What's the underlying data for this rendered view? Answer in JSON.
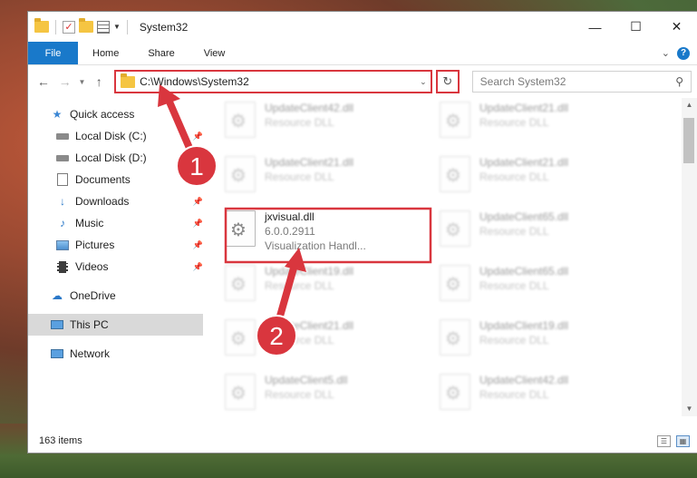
{
  "window": {
    "title": "System32",
    "controls": {
      "minimize": "—",
      "maximize": "☐",
      "close": "✕"
    }
  },
  "ribbon": {
    "tabs": [
      "File",
      "Home",
      "Share",
      "View"
    ],
    "expand_icon": "chevron-down-icon",
    "help_icon": "?"
  },
  "navbar": {
    "address": "C:\\Windows\\System32",
    "search_placeholder": "Search System32"
  },
  "sidebar": {
    "items": [
      {
        "label": "Quick access",
        "icon": "star-icon",
        "pinned": false
      },
      {
        "label": "Local Disk (C:)",
        "icon": "drive-icon",
        "pinned": true
      },
      {
        "label": "Local Disk (D:)",
        "icon": "drive-icon",
        "pinned": false
      },
      {
        "label": "Documents",
        "icon": "documents-icon",
        "pinned": false
      },
      {
        "label": "Downloads",
        "icon": "download-icon",
        "pinned": true
      },
      {
        "label": "Music",
        "icon": "music-icon",
        "pinned": true
      },
      {
        "label": "Pictures",
        "icon": "pictures-icon",
        "pinned": true
      },
      {
        "label": "Videos",
        "icon": "videos-icon",
        "pinned": true
      },
      {
        "label": "OneDrive",
        "icon": "cloud-icon",
        "pinned": false
      },
      {
        "label": "This PC",
        "icon": "computer-icon",
        "pinned": false,
        "selected": true
      },
      {
        "label": "Network",
        "icon": "network-icon",
        "pinned": false
      }
    ]
  },
  "files": {
    "highlighted": {
      "name": "jxvisual.dll",
      "version": "6.0.0.2911",
      "description": "Visualization Handl..."
    },
    "blurred": [
      {
        "name": "UpdateClient42.dll",
        "description": "Resource DLL"
      },
      {
        "name": "UpdateClient21.dll",
        "description": "Resource DLL"
      },
      {
        "name": "UpdateClient21.dll",
        "description": "Resource DLL"
      },
      {
        "name": "UpdateClient21.dll",
        "description": "Resource DLL"
      },
      {
        "name": "UpdateClient65.dll",
        "description": "Resource DLL"
      },
      {
        "name": "UpdateClient19.dll",
        "description": "Resource DLL"
      },
      {
        "name": "UpdateClient65.dll",
        "description": "Resource DLL"
      },
      {
        "name": "UpdateClient21.dll",
        "description": "Resource DLL"
      },
      {
        "name": "UpdateClient19.dll",
        "description": "Resource DLL"
      },
      {
        "name": "UpdateClient5.dll",
        "description": "Resource DLL"
      },
      {
        "name": "UpdateClient42.dll",
        "description": "Resource DLL"
      }
    ]
  },
  "status": {
    "item_count": "163 items"
  },
  "annotations": {
    "step1": "1",
    "step2": "2",
    "color": "#d9363e"
  }
}
